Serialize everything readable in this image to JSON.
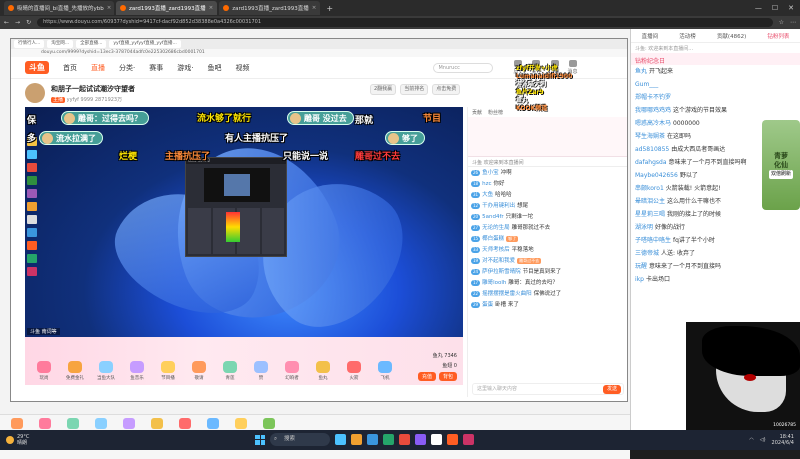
{
  "browser": {
    "tabs": [
      {
        "label": "吸睛的直播间_bi直播_先播放的ybb"
      },
      {
        "label": "zard1993直播_zard1993直播"
      },
      {
        "label": "zard1993直播_zard1993直播"
      }
    ],
    "url": "https://www.douyu.com/60937?dyshid=9417cf-dacf92d852d38388e0a4326c00031701"
  },
  "inner": {
    "tabs": [
      "行情行人...",
      "淘宝网...",
      "全部直播...",
      "yyf直播_yyfyyf直播_yyf直播..."
    ],
    "url": "douyu.com/9999?dyshid=13ec3-3787044adfc0e225302686cbd0001701"
  },
  "nav": {
    "logo": "斗鱼",
    "items": [
      "首页",
      "直播",
      "分类·",
      "赛事",
      "游戏·",
      "鱼吧",
      "视频"
    ],
    "active_index": 1,
    "search_placeholder": "Mnurucc",
    "icons": [
      {
        "label": "历史",
        "icon": "clock-icon"
      },
      {
        "label": "关注",
        "icon": "heart-icon"
      },
      {
        "label": "下载",
        "icon": "download-icon"
      },
      {
        "label": "消息",
        "icon": "message-icon"
      }
    ]
  },
  "room": {
    "title": "和朋子一起试试潮汐守望者",
    "badge": "主播",
    "anchor": "yyfyf",
    "id": "9999",
    "hot": "2871923万",
    "rank": "9万/5万",
    "buttons": [
      "2翻我赢",
      "当前排名",
      "点击免费"
    ]
  },
  "video": {
    "corner_tag": "斗鱼 南词等",
    "danmaku_pills": [
      {
        "text": "雕哥：过得去吗？"
      },
      {
        "text": "流水拉满了"
      },
      {
        "text": "雕哥 没过去"
      },
      {
        "text": "够了"
      }
    ],
    "danmaku_text": [
      {
        "text": "流水够了就行",
        "color": "#ffe600"
      },
      {
        "text": "节目",
        "color": "#ff8c3a"
      },
      {
        "text": "有人主播抗压了",
        "color": "#ffffff"
      },
      {
        "text": "雕哥过不去",
        "color": "#ff3b3b"
      },
      {
        "text": "主播抗压了",
        "color": "#ff8c3a"
      },
      {
        "text": "只能说一说",
        "color": "#ffffff"
      },
      {
        "text": "那就",
        "color": "#ffffff"
      },
      {
        "text": "烂梗",
        "color": "#ffe600"
      },
      {
        "text": "多",
        "color": "#ffffff"
      },
      {
        "text": "保",
        "color": "#ffffff"
      }
    ],
    "obs_title": "OBS 30.0.2"
  },
  "giftbar": {
    "gifts": [
      {
        "label": "玩尚",
        "color": "#ff7b9c"
      },
      {
        "label": "免费金礼",
        "color": "#f7a440"
      },
      {
        "label": "当鱼大队",
        "color": "#8ad0ff"
      },
      {
        "label": "鱼音乐",
        "color": "#c69cff"
      },
      {
        "label": "节目播",
        "color": "#ffcf5c"
      },
      {
        "label": "敬请",
        "color": "#ff9a5c"
      },
      {
        "label": "青莲",
        "color": "#7bd6b1"
      },
      {
        "label": "赞",
        "color": "#9cc0ff"
      },
      {
        "label": "幻响者",
        "color": "#ff8fb0"
      },
      {
        "label": "鱼丸",
        "color": "#f3c04a"
      },
      {
        "label": "火箭",
        "color": "#ff6b6b"
      },
      {
        "label": "飞机",
        "color": "#6bb9ff"
      },
      {
        "label": "节目",
        "color": "#b98cff"
      }
    ],
    "balance": "鱼丸 7346",
    "fishball": "鱼翅 0",
    "recharge": "充值",
    "pack": "背包"
  },
  "sidepanel": {
    "tabs": [
      "贡献",
      "粉丝榜"
    ],
    "notice": "斗鱼 欢迎来到本直播间",
    "messages": [
      {
        "lv": "26",
        "name": "鱼小宝",
        "text": "冲啊"
      },
      {
        "lv": "18",
        "name": "hzc",
        "text": "你好"
      },
      {
        "lv": "31",
        "name": "大鱼",
        "text": "哈哈哈"
      },
      {
        "lv": "12",
        "name": "干办用键利出",
        "text": "想尾"
      },
      {
        "lv": "20",
        "name": "5and4fr",
        "text": "只剩谁一坨"
      },
      {
        "lv": "27",
        "name": "无论的生局",
        "text": "雕哥那就过不去"
      },
      {
        "lv": "15",
        "name": "椰白蛋糕",
        "text": "够了"
      },
      {
        "lv": "33",
        "name": "天师考核后",
        "text": "平稳落地"
      },
      {
        "lv": "19",
        "name": "对不起和我爱",
        "text": "雕哥过不去"
      },
      {
        "lv": "24",
        "name": "萨伊拉斯雪晴院",
        "text": "节目是真到来了"
      },
      {
        "lv": "17",
        "name": "雕哥loolh",
        "text": "雕哥：真过的去吗？"
      },
      {
        "lv": "22",
        "name": "摇摆摆摆是雷火曲阳",
        "text": "保佛说过了"
      },
      {
        "lv": "29",
        "name": "蛋蛋",
        "text": "卧槽 来了"
      }
    ],
    "input_placeholder": "这里输入聊天内容",
    "send": "发送"
  },
  "overlay_text": {
    "lines": [
      "zfyf开发+小虎",
      "Lumanaidifi1900",
      "游泳喵大刺",
      "鱼片Zar9",
      "鱼丸",
      "KOOK频道"
    ]
  },
  "bottomstrip": {
    "items": [
      {
        "label": "任务大厅",
        "color": "#ff9a5c"
      },
      {
        "label": "免费宝典",
        "color": "#ff7b9c"
      },
      {
        "label": "青莲化心",
        "color": "#7bd6b1"
      },
      {
        "label": "高级之旅",
        "color": "#8ad0ff"
      },
      {
        "label": "幻境探索",
        "color": "#c69cff"
      },
      {
        "label": "沙漠迷踪",
        "color": "#f3c04a"
      },
      {
        "label": "送点之盒",
        "color": "#ff6b6b"
      },
      {
        "label": "钻石石榴",
        "color": "#6bb9ff"
      },
      {
        "label": "派对来临",
        "color": "#ffcf5c"
      },
      {
        "label": "合成大西瓜",
        "color": "#7cc55a"
      }
    ]
  },
  "rightpane": {
    "tabs": [
      "直播间",
      "活动榜",
      "贡献(4862)",
      "钻粉列表"
    ],
    "active_index": 3,
    "notice": "斗鱼: 欢迎来到本直播间...",
    "header": "钻粉纪念日",
    "messages": [
      {
        "user": "鱼丸",
        "text": "开飞起来"
      },
      {
        "user": "Gum___",
        "text": ""
      },
      {
        "user": "郑帽卡不钓罗",
        "text": ""
      },
      {
        "user": "我哪哪鸡鸡鸡",
        "text": "这个游戏的节目效果"
      },
      {
        "user": "嗯惑高冷木马",
        "text": "0000000"
      },
      {
        "user": "琴生海娴茶",
        "text": "在这即吗"
      },
      {
        "user": "ad5810855",
        "text": "由成大西瓜者哥画达"
      },
      {
        "user": "dafahgsda",
        "text": "意味来了一个月不到直接吗啊"
      },
      {
        "user": "Maybe042656",
        "text": "野以了"
      },
      {
        "user": "串颇koro1",
        "text": "火箭装载! 火箭意起!"
      },
      {
        "user": "晕暗泪公主",
        "text": "这么用什么干嘛也不"
      },
      {
        "user": "星星莉三喝",
        "text": "我刚的接上了的时候"
      },
      {
        "user": "湖泳明",
        "text": "好像的战行"
      },
      {
        "user": "子嗒咯中咯生",
        "text": "fq讲了半个小时"
      },
      {
        "user": "三德帝城",
        "text": "人送: 收弃了"
      },
      {
        "user": "玩醒",
        "text": "意味来了一个月不到直接吗"
      },
      {
        "user": "ikp",
        "text": "卡出场口"
      }
    ]
  },
  "sticker": {
    "line1": "青萝",
    "line2": "化仙",
    "tag": "双倍刷新"
  },
  "manga": {
    "caption": "10026785"
  },
  "taskbar": {
    "temp": "29°C",
    "weather": "晴朗",
    "search": "搜索",
    "time": "18:41",
    "date": "2024/6/4",
    "apps": [
      "#4cc2ff",
      "#f0a030",
      "#3a96dd",
      "#25a56a",
      "#e84b3c",
      "#8a5cf6",
      "#ffffff",
      "#ff5d23",
      "#cc3366"
    ]
  }
}
